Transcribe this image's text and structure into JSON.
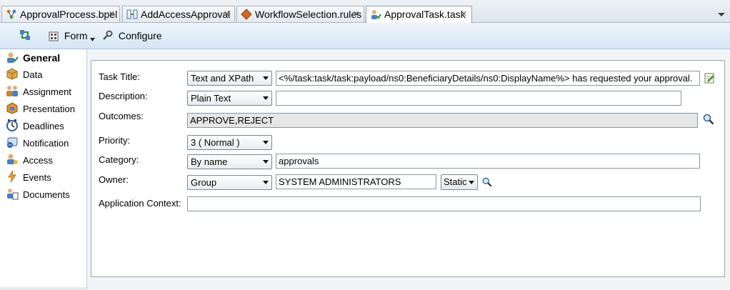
{
  "tabs": [
    {
      "label": "ApprovalProcess.bpel",
      "icon": "bpel-process-icon",
      "active": false
    },
    {
      "label": "AddAccessApproval",
      "icon": "composite-icon",
      "active": false
    },
    {
      "label": "WorkflowSelection.rules",
      "icon": "rules-icon",
      "active": false
    },
    {
      "label": "ApprovalTask.task",
      "icon": "human-task-icon",
      "active": true
    }
  ],
  "tab_close_glyph": "✕",
  "toolbar": {
    "form_label": "Form",
    "configure_label": "Configure"
  },
  "nav": {
    "items": [
      {
        "label": "General",
        "icon": "general-icon",
        "selected": true
      },
      {
        "label": "Data",
        "icon": "data-icon"
      },
      {
        "label": "Assignment",
        "icon": "assignment-icon"
      },
      {
        "label": "Presentation",
        "icon": "presentation-icon"
      },
      {
        "label": "Deadlines",
        "icon": "deadlines-icon"
      },
      {
        "label": "Notification",
        "icon": "notification-icon"
      },
      {
        "label": "Access",
        "icon": "access-icon"
      },
      {
        "label": "Events",
        "icon": "events-icon"
      },
      {
        "label": "Documents",
        "icon": "documents-icon"
      }
    ]
  },
  "form": {
    "task_title": {
      "label": "Task Title:",
      "mode": "Text and XPath",
      "value": "<%/task:task/task:payload/ns0:BeneficiaryDetails/ns0:DisplayName%> has requested your approval."
    },
    "description": {
      "label": "Description:",
      "mode": "Plain Text",
      "value": ""
    },
    "outcomes": {
      "label": "Outcomes:",
      "value": "APPROVE,REJECT"
    },
    "priority": {
      "label": "Priority:",
      "value": "3  ( Normal )"
    },
    "category": {
      "label": "Category:",
      "mode": "By name",
      "value": "approvals"
    },
    "owner": {
      "label": "Owner:",
      "mode": "Group",
      "value": "SYSTEM ADMINISTRATORS",
      "type": "Static"
    },
    "application_context": {
      "label": "Application Context:",
      "value": ""
    }
  },
  "colors": {
    "tab_strip": "#dde5ee",
    "toolbar": "#d6e6f6",
    "panel_border": "#9aa6b2",
    "readonly_field": "#e6e6e6"
  }
}
